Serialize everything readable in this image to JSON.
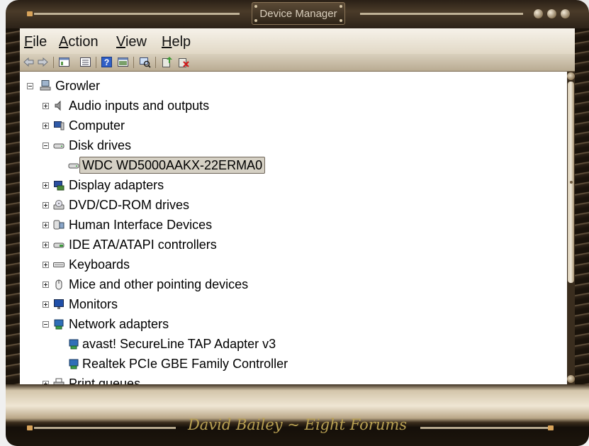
{
  "window": {
    "title": "Device Manager",
    "signature": "David Bailey ~ Eight Forums"
  },
  "menu": [
    {
      "mnemonic": "F",
      "rest": "ile"
    },
    {
      "mnemonic": "A",
      "rest": "ction"
    },
    {
      "mnemonic": "V",
      "rest": "iew"
    },
    {
      "mnemonic": "H",
      "rest": "elp"
    }
  ],
  "toolbar": {
    "buttons": [
      "back-icon",
      "forward-icon",
      "properties-icon",
      "update-driver-list-icon",
      "help-icon",
      "view-icon",
      "scan-hardware-icon",
      "update-driver-icon",
      "uninstall-icon"
    ]
  },
  "tree": {
    "root": "Growler",
    "categories": [
      {
        "label": "Audio inputs and outputs",
        "icon": "speaker-icon",
        "expanded": false
      },
      {
        "label": "Computer",
        "icon": "computer-icon",
        "expanded": false
      },
      {
        "label": "Disk drives",
        "icon": "disk-drive-icon",
        "expanded": true,
        "children": [
          {
            "label": "WDC WD5000AAKX-22ERMA0",
            "icon": "disk-drive-icon",
            "selected": true
          }
        ]
      },
      {
        "label": "Display adapters",
        "icon": "display-adapter-icon",
        "expanded": false
      },
      {
        "label": "DVD/CD-ROM drives",
        "icon": "dvd-drive-icon",
        "expanded": false
      },
      {
        "label": "Human Interface Devices",
        "icon": "hid-icon",
        "expanded": false
      },
      {
        "label": "IDE ATA/ATAPI controllers",
        "icon": "ide-controller-icon",
        "expanded": false
      },
      {
        "label": "Keyboards",
        "icon": "keyboard-icon",
        "expanded": false
      },
      {
        "label": "Mice and other pointing devices",
        "icon": "mouse-icon",
        "expanded": false
      },
      {
        "label": "Monitors",
        "icon": "monitor-icon",
        "expanded": false
      },
      {
        "label": "Network adapters",
        "icon": "network-adapter-icon",
        "expanded": true,
        "children": [
          {
            "label": "avast! SecureLine TAP Adapter v3",
            "icon": "network-adapter-icon"
          },
          {
            "label": "Realtek PCIe GBE Family Controller",
            "icon": "network-adapter-icon"
          }
        ]
      },
      {
        "label": "Print queues",
        "icon": "printer-icon",
        "expanded": false
      }
    ]
  },
  "colors": {
    "frame_dark": "#2a2016",
    "frame_bronze": "#6e5c44",
    "menu_bg": "#f6f2ea",
    "selection_bg": "#d5d0c4",
    "signature_gold": "#b9a153",
    "toolbar_bg": "#c9bda5"
  }
}
